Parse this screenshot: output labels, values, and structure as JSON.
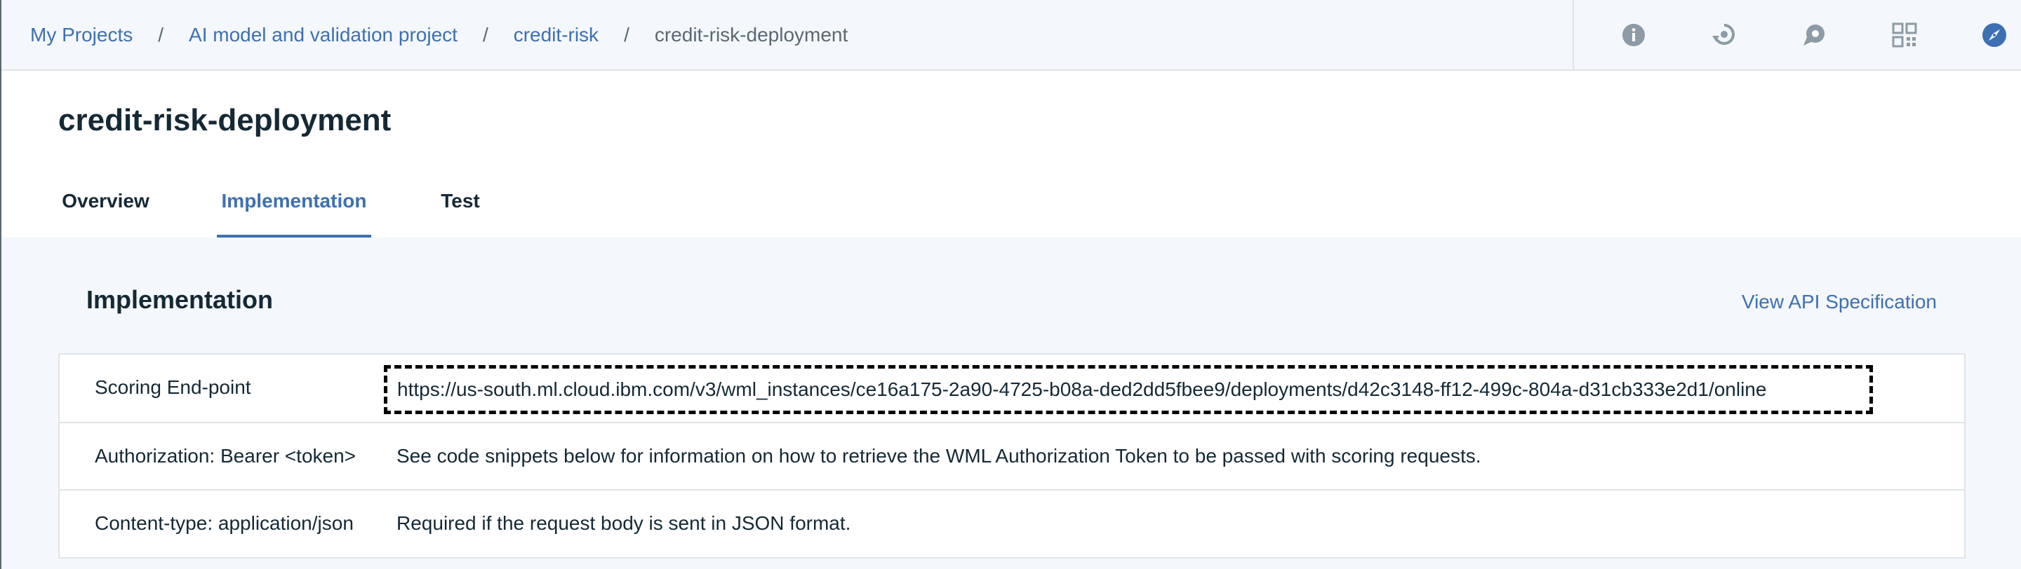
{
  "breadcrumb": {
    "items": [
      {
        "label": "My Projects"
      },
      {
        "label": "AI model and validation project"
      },
      {
        "label": "credit-risk"
      }
    ],
    "separator": "/",
    "current": "credit-risk-deployment"
  },
  "toolbar": {
    "icons": [
      "info-icon",
      "refresh-icon",
      "chat-icon",
      "qr-code-icon",
      "compass-icon"
    ]
  },
  "header": {
    "title": "credit-risk-deployment",
    "tabs": [
      {
        "label": "Overview",
        "active": false
      },
      {
        "label": "Implementation",
        "active": true
      },
      {
        "label": "Test",
        "active": false
      }
    ]
  },
  "content": {
    "section_title": "Implementation",
    "api_link": "View API Specification",
    "rows": [
      {
        "label": "Scoring End-point",
        "value": "https://us-south.ml.cloud.ibm.com/v3/wml_instances/ce16a175-2a90-4725-b08a-ded2dd5fbee9/deployments/d42c3148-ff12-499c-804a-d31cb333e2d1/online"
      },
      {
        "label": "Authorization: Bearer <token>",
        "value": "See code snippets below for information on how to retrieve the WML Authorization Token to be passed with scoring requests."
      },
      {
        "label": "Content-type: application/json",
        "value": "Required if the request body is sent in JSON format."
      }
    ]
  },
  "colors": {
    "accent": "#3d70b2",
    "text": "#152935",
    "muted": "#5a6872",
    "background": "#f4f7fb",
    "border": "#dfe3e6",
    "icon": "#8c9ba5"
  }
}
